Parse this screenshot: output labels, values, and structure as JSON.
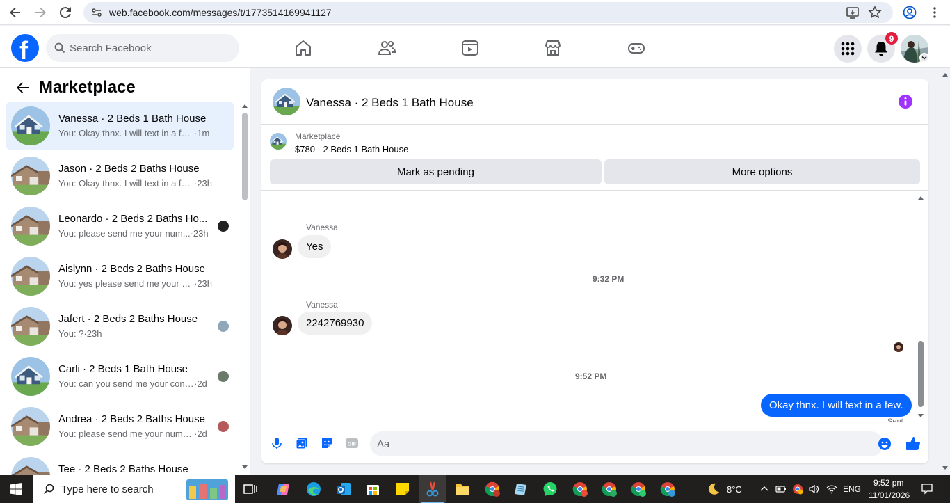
{
  "browser": {
    "url": "web.facebook.com/messages/t/1773514169941127"
  },
  "header": {
    "search_placeholder": "Search Facebook",
    "notification_count": "9",
    "brand_color": "#0866ff"
  },
  "sidebar": {
    "title": "Marketplace",
    "conversations": [
      {
        "name": "Vanessa · 2 Beds 1 Bath House",
        "snippet": "You: Okay thnx. I will text in a few.",
        "time": "·1m",
        "active": true
      },
      {
        "name": "Jason · 2 Beds 2 Baths House",
        "snippet": "You: Okay thnx. I will text in a few.",
        "time": "·23h",
        "active": false
      },
      {
        "name": "Leonardo · 2 Beds 2 Baths Ho...",
        "snippet": "You: please send me your num...",
        "time": "·23h",
        "active": false
      },
      {
        "name": "Aislynn · 2 Beds 2 Baths House",
        "snippet": "You: yes please send me your nu...",
        "time": "·23h",
        "active": false
      },
      {
        "name": "Jafert · 2 Beds 2 Baths House",
        "snippet": "You: ?",
        "time": "·23h",
        "active": false
      },
      {
        "name": "Carli · 2 Beds 1 Bath House",
        "snippet": "You: can you send me your cont...",
        "time": "·2d",
        "active": false
      },
      {
        "name": "Andrea · 2 Beds 2 Baths House",
        "snippet": "You: please send me your numb...",
        "time": "·2d",
        "active": false
      },
      {
        "name": "Tee · 2 Beds 2 Baths House",
        "snippet": "",
        "time": "",
        "active": false
      }
    ]
  },
  "chat": {
    "title": "Vanessa · 2 Beds 1 Bath House",
    "listing_label": "Marketplace",
    "listing_price": "$780 - 2 Beds 1 Bath House",
    "mark_pending_label": "Mark as pending",
    "more_options_label": "More options",
    "messages": [
      {
        "sender": "Vanessa",
        "text": "Yes",
        "direction": "in"
      },
      {
        "timestamp": "9:32 PM"
      },
      {
        "sender": "Vanessa",
        "text": "2242769930",
        "direction": "in"
      },
      {
        "timestamp": "9:52 PM"
      },
      {
        "sender": "You",
        "text": "Okay thnx. I will text in a few.",
        "direction": "out",
        "status": "Sent"
      }
    ],
    "composer_placeholder": "Aa"
  },
  "taskbar": {
    "search_placeholder": "Type here to search",
    "weather": "8°C",
    "language": "ENG",
    "time": "9:52 pm",
    "date": "11/01/2026"
  }
}
